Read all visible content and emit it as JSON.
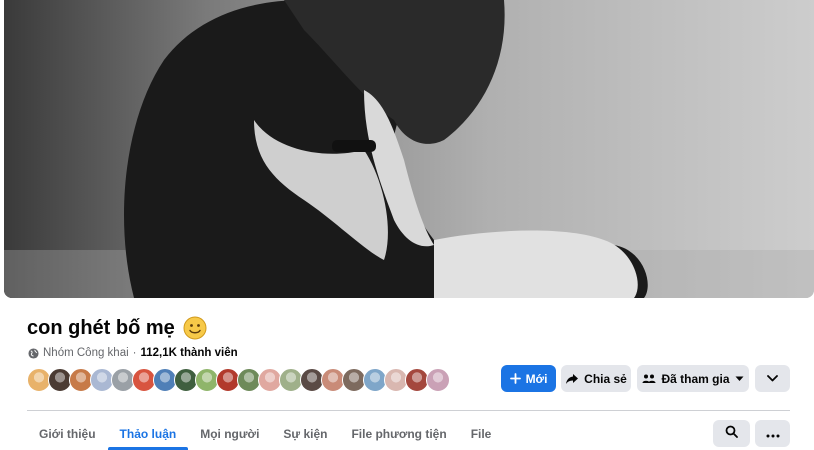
{
  "cover": {
    "image_desc": "cover-photo"
  },
  "group": {
    "name": "con ghét bố mẹ",
    "emoji": "slightly-smiling-face-icon",
    "privacy": "Nhóm Công khai",
    "separator": "·",
    "members": "112,1K thành viên"
  },
  "member_avatars": [
    {
      "color": "#e8b26a"
    },
    {
      "color": "#4b3b33"
    },
    {
      "color": "#c77a48"
    },
    {
      "color": "#aab8d3"
    },
    {
      "color": "#9aa0a6"
    },
    {
      "color": "#d8543f"
    },
    {
      "color": "#4f7fb7"
    },
    {
      "color": "#3f5f3f"
    },
    {
      "color": "#8fb56a"
    },
    {
      "color": "#b23a2c"
    },
    {
      "color": "#6e8a5a"
    },
    {
      "color": "#e0a8a0"
    },
    {
      "color": "#9fb08a"
    },
    {
      "color": "#5a4a45"
    },
    {
      "color": "#c98b78"
    },
    {
      "color": "#7d6a5e"
    },
    {
      "color": "#7fa6c9"
    },
    {
      "color": "#d9b7b0"
    },
    {
      "color": "#a4483e"
    },
    {
      "color": "#caa1b6"
    }
  ],
  "actions": {
    "new_label": "Mới",
    "share_label": "Chia sẻ",
    "joined_label": "Đã tham gia"
  },
  "tabs": [
    {
      "label": "Giới thiệu",
      "active": false
    },
    {
      "label": "Thảo luận",
      "active": true
    },
    {
      "label": "Mọi người",
      "active": false
    },
    {
      "label": "Sự kiện",
      "active": false
    },
    {
      "label": "File phương tiện",
      "active": false
    },
    {
      "label": "File",
      "active": false
    }
  ],
  "colors": {
    "accent": "#1b74e4",
    "secondary_button": "#e4e6eb",
    "muted_text": "#65676b"
  }
}
